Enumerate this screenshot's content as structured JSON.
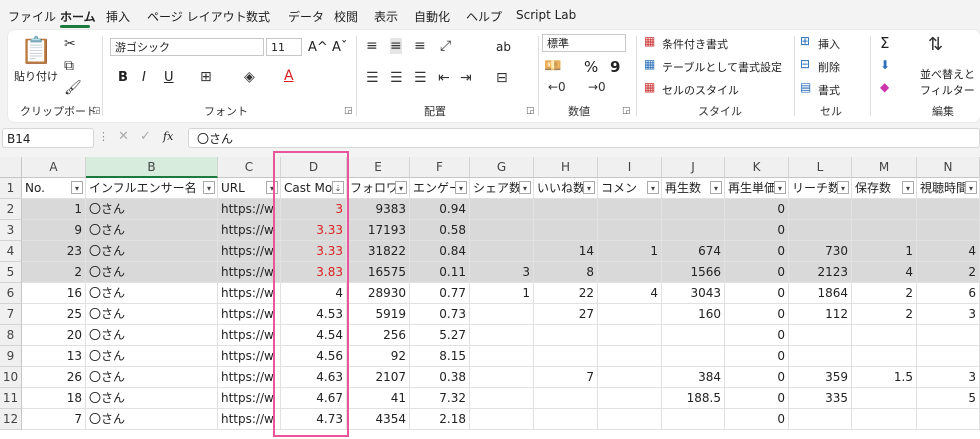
{
  "menu": {
    "tabs": [
      "ファイル",
      "ホーム",
      "挿入",
      "ページ レイアウト",
      "数式",
      "データ",
      "校閲",
      "表示",
      "自動化",
      "ヘルプ",
      "Script Lab"
    ],
    "active_tab": "ホーム"
  },
  "ribbon": {
    "clipboard": {
      "paste_label": "貼り付け",
      "group_label": "クリップボード"
    },
    "font": {
      "font_name": "游ゴシック",
      "font_size": "11",
      "grow": "A^",
      "shrink": "Aˇ",
      "bold": "B",
      "italic": "I",
      "underline": "U",
      "font_color": "A",
      "group_label": "フォント"
    },
    "alignment": {
      "wrap": "ab",
      "group_label": "配置"
    },
    "number": {
      "format": "標準",
      "percent": "%",
      "comma": "9",
      "group_label": "数値"
    },
    "styles": {
      "conditional": "条件付き書式",
      "as_table": "テーブルとして書式設定",
      "cell_styles": "セルのスタイル",
      "group_label": "スタイル"
    },
    "cells": {
      "insert": "挿入",
      "delete": "削除",
      "format": "書式",
      "group_label": "セル"
    },
    "editing": {
      "sum": "Σ",
      "sort_filter_1": "並べ替えと",
      "sort_filter_2": "フィルター",
      "group_label": "編集"
    }
  },
  "formula_bar": {
    "name_box": "B14",
    "fx": "fx",
    "value": "〇さん"
  },
  "sheet": {
    "column_letters": [
      "A",
      "B",
      "C",
      "D",
      "E",
      "F",
      "G",
      "H",
      "I",
      "J",
      "K",
      "L",
      "M",
      "N"
    ],
    "selected_column": "B",
    "header_row": [
      "No.",
      "インフルエンサー名",
      "URL",
      "Cast Mo",
      "フォロワ",
      "エンゲー",
      "シェア数",
      "いいね数",
      "コメン",
      "再生数",
      "再生単価",
      "リーチ数",
      "保存数",
      "視聴時間"
    ],
    "rows": [
      {
        "n": "2",
        "cells": [
          "1",
          "〇さん",
          "https://w",
          "3",
          "9383",
          "0.94",
          "",
          "",
          "",
          "",
          "0",
          "",
          "",
          ""
        ],
        "shaded": true,
        "red": true
      },
      {
        "n": "3",
        "cells": [
          "9",
          "〇さん",
          "https://w",
          "3.33",
          "17193",
          "0.58",
          "",
          "",
          "",
          "",
          "0",
          "",
          "",
          ""
        ],
        "shaded": true,
        "red": true
      },
      {
        "n": "4",
        "cells": [
          "23",
          "〇さん",
          "https://w",
          "3.33",
          "31822",
          "0.84",
          "",
          "14",
          "1",
          "674",
          "0",
          "730",
          "1",
          "4"
        ],
        "shaded": true,
        "red": true
      },
      {
        "n": "5",
        "cells": [
          "2",
          "〇さん",
          "https://w",
          "3.83",
          "16575",
          "0.11",
          "3",
          "8",
          "",
          "1566",
          "0",
          "2123",
          "4",
          "2"
        ],
        "shaded": true,
        "red": true
      },
      {
        "n": "6",
        "cells": [
          "16",
          "〇さん",
          "https://w",
          "4",
          "28930",
          "0.77",
          "1",
          "22",
          "4",
          "3043",
          "0",
          "1864",
          "2",
          "6"
        ],
        "shaded": false,
        "red": false
      },
      {
        "n": "7",
        "cells": [
          "25",
          "〇さん",
          "https://w",
          "4.53",
          "5919",
          "0.73",
          "",
          "27",
          "",
          "160",
          "0",
          "112",
          "2",
          "3"
        ],
        "shaded": false,
        "red": false
      },
      {
        "n": "8",
        "cells": [
          "20",
          "〇さん",
          "https://w",
          "4.54",
          "256",
          "5.27",
          "",
          "",
          "",
          "",
          "0",
          "",
          "",
          ""
        ],
        "shaded": false,
        "red": false
      },
      {
        "n": "9",
        "cells": [
          "13",
          "〇さん",
          "https://w",
          "4.56",
          "92",
          "8.15",
          "",
          "",
          "",
          "",
          "0",
          "",
          "",
          ""
        ],
        "shaded": false,
        "red": false
      },
      {
        "n": "10",
        "cells": [
          "26",
          "〇さん",
          "https://w",
          "4.63",
          "2107",
          "0.38",
          "",
          "7",
          "",
          "384",
          "0",
          "359",
          "1.5",
          "3"
        ],
        "shaded": false,
        "red": false
      },
      {
        "n": "11",
        "cells": [
          "18",
          "〇さん",
          "https://w",
          "4.67",
          "41",
          "7.32",
          "",
          "",
          "",
          "188.5",
          "0",
          "335",
          "",
          "5"
        ],
        "shaded": false,
        "red": false
      },
      {
        "n": "12",
        "cells": [
          "7",
          "〇さん",
          "https://w",
          "4.73",
          "4354",
          "2.18",
          "",
          "",
          "",
          "",
          "0",
          "",
          "",
          ""
        ],
        "shaded": false,
        "red": false
      }
    ]
  },
  "colors": {
    "accent": "#1d7a3e",
    "highlight_frame": "#e8559a",
    "red_text": "#d92020",
    "shaded_row": "#d9d9d9"
  }
}
